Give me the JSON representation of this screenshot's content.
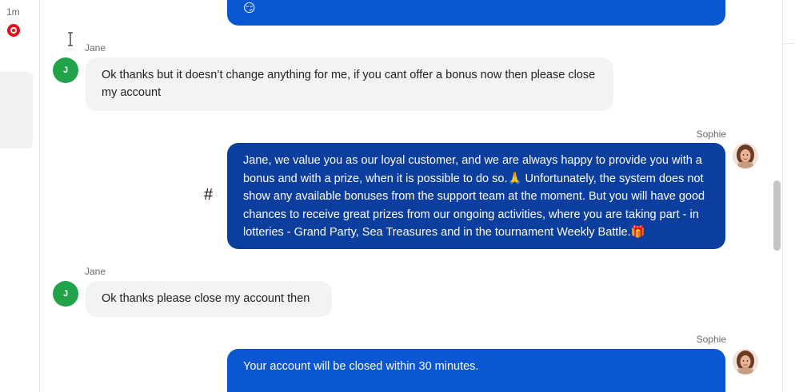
{
  "rail": {
    "time": "1m"
  },
  "messages": [
    {
      "id": "m0",
      "emoji": "😏"
    },
    {
      "id": "m1",
      "sender": "Jane",
      "avatar_initial": "J",
      "text": "Ok thanks but it doesn’t change anything for me, if you cant offer a bonus now then please close my account"
    },
    {
      "id": "m2",
      "sender": "Sophie",
      "text": "Jane, we value you as our loyal customer, and we are always happy to provide you with a bonus and with a prize, when it is possible to do so.🙏 Unfortunately, the system does not show any available bonuses from the support team at the moment. But you will have good chances to receive great prizes from our ongoing activities, where you are taking part - in lotteries - Grand Party, Sea Treasures and in the tournament Weekly Battle.🎁"
    },
    {
      "id": "m3",
      "sender": "Jane",
      "avatar_initial": "J",
      "text": "Ok thanks please close my account then"
    },
    {
      "id": "m4",
      "sender": "Sophie",
      "text": "Your account will be closed within 30 minutes."
    }
  ],
  "hash_symbol": "#",
  "colors": {
    "agent_bubble": "#0a56d3",
    "agent_bubble_selected": "#0b3e9e",
    "user_bubble": "#f3f3f3",
    "user_avatar": "#21a34a",
    "status_dot": "#e0101d"
  }
}
